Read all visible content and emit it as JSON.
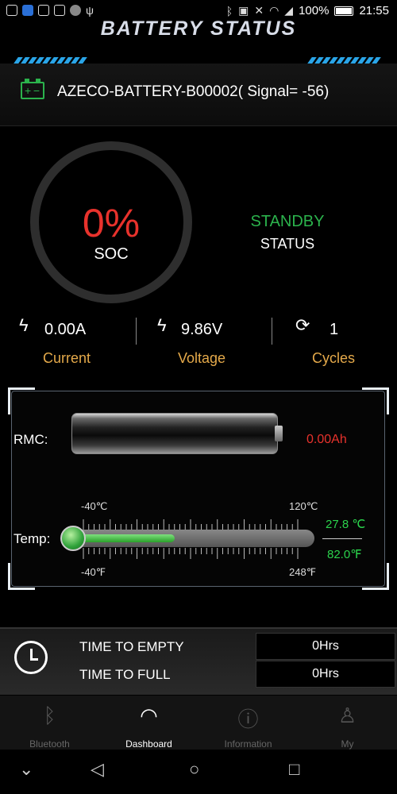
{
  "statusbar": {
    "battery_percent": "100%",
    "time": "21:55"
  },
  "header": {
    "title": "BATTERY STATUS"
  },
  "device": {
    "name": "AZECO-BATTERY-B00002( Signal= -56)",
    "icon": "battery-icon"
  },
  "soc": {
    "value": "0%",
    "label": "SOC",
    "state_value": "STANDBY",
    "state_label": "STATUS"
  },
  "metrics": {
    "current_value": "0.00A",
    "current_label": "Current",
    "voltage_value": "9.86V",
    "voltage_label": "Voltage",
    "cycles_value": "1",
    "cycles_label": "Cycles"
  },
  "rmc": {
    "label": "RMC:",
    "value": "0.00Ah",
    "fill_fraction": 0
  },
  "temp": {
    "label": "Temp:",
    "min_c": "-40℃",
    "max_c": "120℃",
    "min_f": "-40℉",
    "max_f": "248℉",
    "value_c": "27.8 ℃",
    "value_f": "82.0℉",
    "fill_fraction": 0.43
  },
  "time": {
    "to_empty_label": "TIME TO EMPTY",
    "to_empty_value": "0Hrs",
    "to_full_label": "TIME TO FULL",
    "to_full_value": "0Hrs"
  },
  "tabs": [
    {
      "label": "Bluetooth",
      "icon": "bluetooth-icon"
    },
    {
      "label": "Dashboard",
      "icon": "gauge-icon"
    },
    {
      "label": "Information",
      "icon": "info-icon"
    },
    {
      "label": "My",
      "icon": "user-icon"
    }
  ],
  "colors": {
    "accent_green": "#2bb24c",
    "alert_red": "#e8322c",
    "label_amber": "#e4a94a",
    "header_blue": "#2aa5e8"
  }
}
